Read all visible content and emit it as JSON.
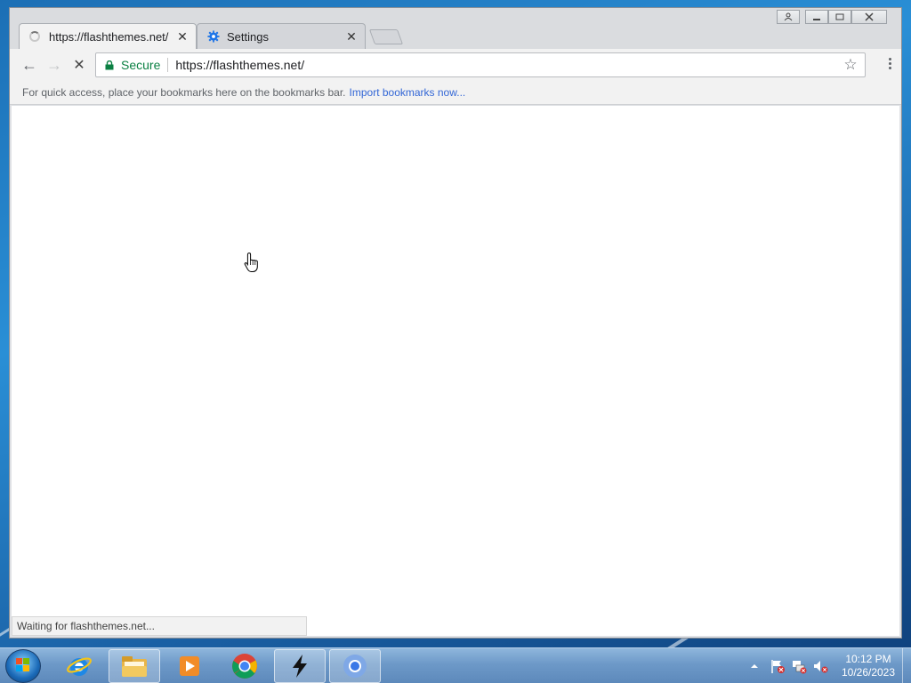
{
  "tabs": [
    {
      "title": "https://flashthemes.net/",
      "close": "✕",
      "icon": "loading-spinner-icon"
    },
    {
      "title": "Settings",
      "close": "✕",
      "icon": "gear-icon"
    }
  ],
  "toolbar": {
    "back": "←",
    "forward": "→",
    "stop": "✕",
    "secure_label": "Secure",
    "url": "https://flashthemes.net/",
    "bookmark_star": "☆"
  },
  "bookmarks_bar": {
    "hint": "For quick access, place your bookmarks here on the bookmarks bar.",
    "import_link": "Import bookmarks now..."
  },
  "status_bar": {
    "text": "Waiting for flashthemes.net..."
  },
  "taskbar": {
    "apps": [
      "internet-explorer",
      "windows-explorer",
      "media-player",
      "google-chrome",
      "flash-app",
      "chromium"
    ],
    "clock_time": "10:12 PM",
    "clock_date": "10/26/2023"
  },
  "colors": {
    "secure": "#0b8043",
    "link": "#3367d6",
    "tab_active": "#f2f2f2"
  }
}
